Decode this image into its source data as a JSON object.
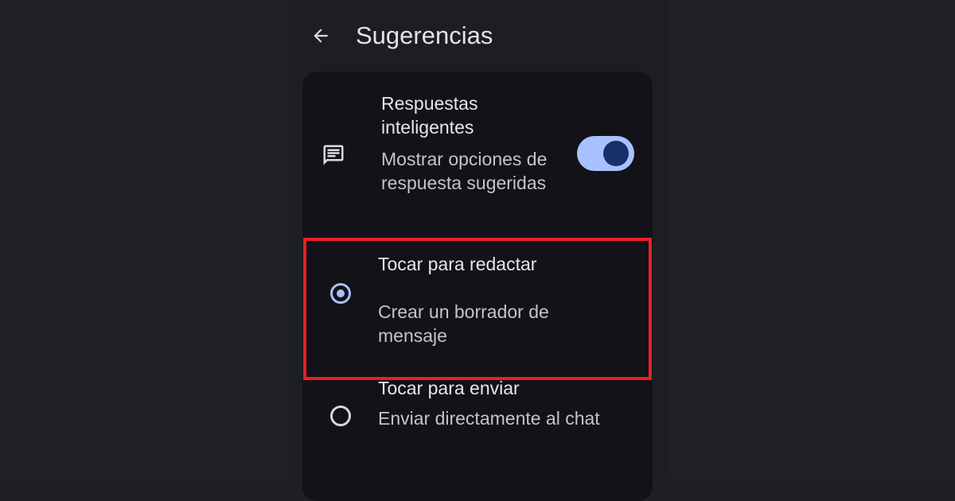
{
  "header": {
    "title": "Sugerencias",
    "back_icon": "arrow-back-icon"
  },
  "settings": {
    "smart_replies": {
      "title": "Respuestas inteligentes",
      "subtitle": "Mostrar opciones de respuesta sugeridas",
      "icon": "message-icon",
      "enabled": true
    },
    "tap_to_compose": {
      "title": "Tocar para redactar",
      "subtitle": "Crear un borrador de mensaje",
      "selected": true
    },
    "tap_to_send": {
      "title": "Tocar para enviar",
      "subtitle": "Enviar directamente al chat",
      "selected": false
    }
  },
  "colors": {
    "background": "#1d1e22",
    "card": "#121218",
    "accent": "#a8c1ff",
    "highlight": "#e81f2b",
    "text_primary": "#e6e6ea",
    "text_secondary": "#c3c4ca"
  }
}
